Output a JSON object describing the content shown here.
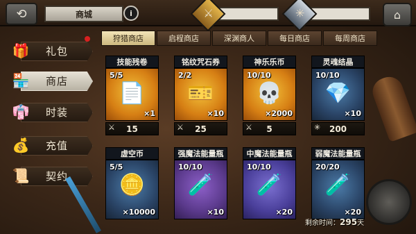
{
  "header": {
    "title": "商城",
    "currency_left": "",
    "currency_right": ""
  },
  "nav": {
    "items": [
      {
        "label": "礼包",
        "icon": "gift-box-icon"
      },
      {
        "label": "商店",
        "icon": "shop-icon"
      },
      {
        "label": "时装",
        "icon": "costume-icon"
      },
      {
        "label": "充值",
        "icon": "money-bag-icon"
      },
      {
        "label": "契约",
        "icon": "contract-book-icon"
      }
    ],
    "active_index": 1
  },
  "tabs": [
    "狩猎商店",
    "启程商店",
    "深渊商人",
    "每日商店",
    "每周商店"
  ],
  "active_tab": 0,
  "cards": [
    {
      "title": "技能残卷",
      "stock": "5/5",
      "qty": "×1",
      "price": "15",
      "theme": "gold",
      "icon": "scroll-pages-icon",
      "price_icon": "crossed-swords-icon"
    },
    {
      "title": "铭纹咒石券",
      "stock": "2/2",
      "qty": "×10",
      "price": "25",
      "theme": "gold",
      "icon": "rune-ticket-icon",
      "price_icon": "crossed-swords-icon"
    },
    {
      "title": "神乐乐币",
      "stock": "10/10",
      "qty": "×2000",
      "price": "5",
      "theme": "gold",
      "icon": "skull-coin-icon",
      "price_icon": "crossed-swords-icon"
    },
    {
      "title": "灵魂结晶",
      "stock": "10/10",
      "qty": "×10",
      "price": "200",
      "theme": "blue",
      "icon": "soul-crystal-icon",
      "price_icon": "snowflake-icon"
    },
    {
      "title": "虚空币",
      "stock": "5/5",
      "qty": "×10000",
      "price": "",
      "theme": "blue",
      "icon": "void-coin-icon",
      "price_icon": ""
    },
    {
      "title": "强魔法能量瓶",
      "stock": "10/10",
      "qty": "×10",
      "price": "",
      "theme": "purple",
      "icon": "orange-vial-icon",
      "price_icon": ""
    },
    {
      "title": "中魔法能量瓶",
      "stock": "10/10",
      "qty": "×20",
      "price": "",
      "theme": "violet",
      "icon": "purple-vial-icon",
      "price_icon": ""
    },
    {
      "title": "弱魔法能量瓶",
      "stock": "20/20",
      "qty": "×20",
      "price": "",
      "theme": "blue",
      "icon": "blue-vial-icon",
      "price_icon": ""
    }
  ],
  "footer": {
    "remaining_label": "剩余时间：",
    "remaining_value": "295",
    "remaining_unit": "天"
  }
}
